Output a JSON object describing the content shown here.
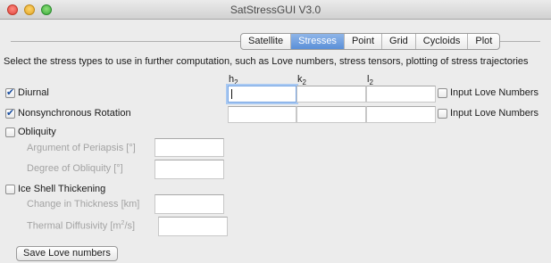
{
  "window": {
    "title": "SatStressGUI V3.0"
  },
  "tabs": [
    {
      "label": "Satellite",
      "active": false
    },
    {
      "label": "Stresses",
      "active": true
    },
    {
      "label": "Point",
      "active": false
    },
    {
      "label": "Grid",
      "active": false
    },
    {
      "label": "Cycloids",
      "active": false
    },
    {
      "label": "Plot",
      "active": false
    }
  ],
  "intro": "Select the stress types to use in further computation, such as Love numbers, stress tensors, plotting of stress trajectories",
  "columns": {
    "h": "h",
    "k": "k",
    "l": "l",
    "sub": "2"
  },
  "stresses": {
    "diurnal": {
      "label": "Diurnal",
      "checked": true,
      "love_label": "Input Love Numbers"
    },
    "nsr": {
      "label": "Nonsynchronous Rotation",
      "checked": true,
      "love_label": "Input Love Numbers"
    },
    "obliquity": {
      "label": "Obliquity",
      "checked": false,
      "periapsis_label": "Argument of Periapsis [°]",
      "degree_label": "Degree of Obliquity [°]"
    },
    "ice": {
      "label": "Ice Shell Thickening",
      "checked": false,
      "thickness_label": "Change in Thickness [km]",
      "diffusivity_label": "Thermal Diffusivity [m",
      "diffusivity_sup": "2",
      "diffusivity_tail": "/s]"
    }
  },
  "save_button": "Save Love numbers"
}
